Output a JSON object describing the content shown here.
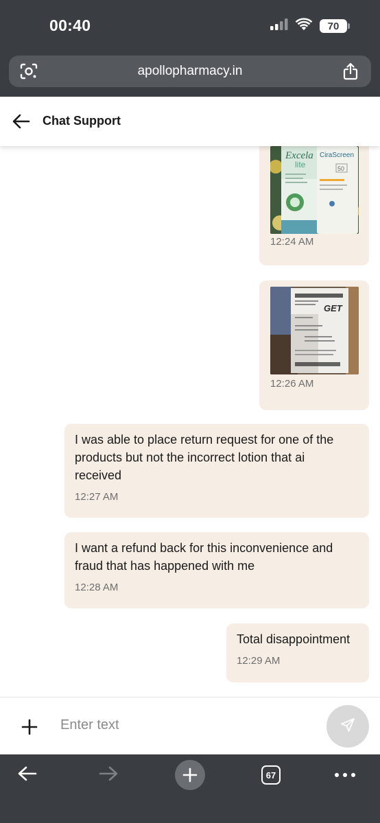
{
  "status_bar": {
    "time": "00:40",
    "battery": "70",
    "icons": [
      "cellular-signal-icon",
      "wifi-icon",
      "battery-icon"
    ]
  },
  "browser": {
    "url": "apollopharmacy.in",
    "left_icon": "page-lens-icon",
    "right_icon": "share-icon"
  },
  "header": {
    "back_icon": "back-arrow-icon",
    "title": "Chat Support"
  },
  "messages": [
    {
      "type": "image",
      "image": "product-photo",
      "time": "12:24 AM"
    },
    {
      "type": "image",
      "image": "receipt-photo",
      "time": "12:26 AM"
    },
    {
      "type": "text",
      "lines": [
        "I was able to place return request for one of the",
        "products but not the incorrect lotion that ai",
        "received"
      ],
      "time": "12:27 AM"
    },
    {
      "type": "text",
      "lines": [
        "I want a refund back for this inconvenience and",
        "fraud that has happened with me"
      ],
      "time": "12:28 AM"
    },
    {
      "type": "text",
      "lines": [
        "Total disappointment"
      ],
      "time": "12:29 AM"
    }
  ],
  "photo_text": {
    "product_brand_1": "Excela",
    "product_variant_1": "lite",
    "product_brand_2": "CiraScreen",
    "product_spf": "50",
    "receipt_mark": "GET"
  },
  "composer": {
    "add_icon": "plus-icon",
    "placeholder": "Enter text",
    "send_icon": "send-icon"
  },
  "bottom_bar": {
    "icons": [
      "back-icon",
      "forward-icon",
      "new-tab-icon",
      "tabs-icon",
      "more-icon"
    ],
    "tabs_count": "67"
  },
  "colors": {
    "chrome": "#3a3d41",
    "url_bar": "#55595e",
    "bubble": "#f6ede4",
    "timestamp": "#6f6f6f",
    "send_button": "#d9d9d9"
  }
}
